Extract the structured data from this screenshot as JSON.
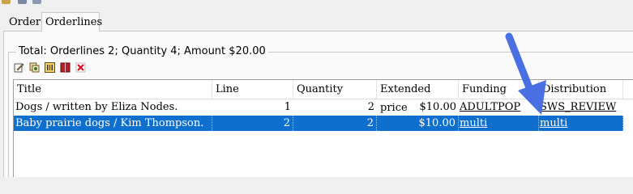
{
  "tabs": {
    "order": "Order",
    "orderlines": "Orderlines"
  },
  "summary": {
    "text": "Total:  Orderlines 2;  Quantity 4;  Amount $20.00"
  },
  "toolbar": {
    "icons": [
      "edit-icon",
      "copy-icon",
      "barcode-icon",
      "book-icon",
      "delete-icon"
    ]
  },
  "table": {
    "headers": {
      "title": "Title",
      "line": "Line",
      "quantity": "Quantity",
      "extended_price": "Extended price",
      "funding": "Funding",
      "distribution": "Distribution"
    },
    "rows": [
      {
        "title": "Dogs / written by Eliza Nodes.",
        "line": "1",
        "quantity": "2",
        "extended_price": "$10.00",
        "funding": "ADULTPOP",
        "distribution": "SWS_REVIEW"
      },
      {
        "title": "Baby prairie dogs / Kim Thompson.",
        "line": "2",
        "quantity": "2",
        "extended_price": "$10.00",
        "funding": "multi",
        "distribution": "multi"
      }
    ]
  },
  "colors": {
    "selection": "#0f6fcf",
    "arrow": "#4a6fe3"
  }
}
